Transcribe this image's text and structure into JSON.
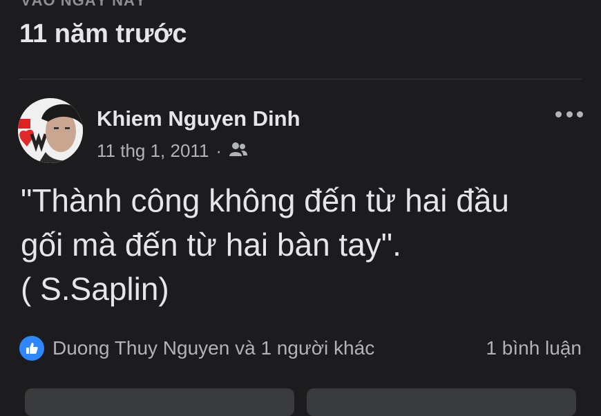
{
  "memory": {
    "section_label": "VÀO NGÀY NÀY",
    "years_ago": "11 năm trước"
  },
  "post": {
    "author": "Khiem Nguyen Dinh",
    "date": "11 thg 1, 2011",
    "separator": "·",
    "audience_icon": "friends-icon",
    "text": "\"Thành công không đến từ hai đầu\ngối mà đến từ hai bàn tay\".\n( S.Saplin)",
    "reactions_text": "Duong Thuy Nguyen và 1 người khác",
    "reaction_icon": "like-icon",
    "comments_text": "1 bình luận"
  },
  "colors": {
    "background": "#1c1c1e",
    "text_primary": "#e4e6eb",
    "text_secondary": "#b0b3b8",
    "like_blue": "#2d88ff",
    "button_bg": "#3a3b3c"
  }
}
